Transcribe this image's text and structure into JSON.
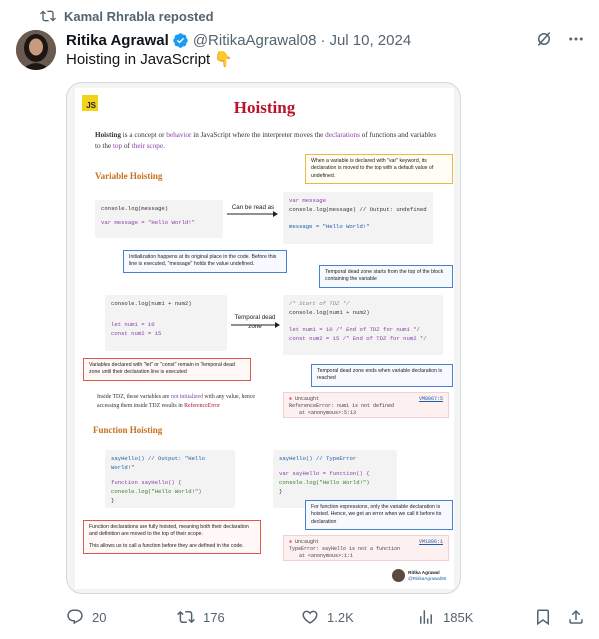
{
  "repost": {
    "text": "Kamal Rhrabla reposted"
  },
  "author": {
    "name": "Ritika Agrawal",
    "handle": "@RitikaAgrawal08",
    "date": "Jul 10, 2024"
  },
  "tweet": {
    "text": "Hoisting in JavaScript 👇"
  },
  "infographic": {
    "logo": "JS",
    "title": "Hoisting",
    "intro": {
      "term": "Hoisting",
      "p1": " is a concept or ",
      "behavior": "behavior",
      "p2": " in JavaScript where the interpreter moves the ",
      "declarations": "declarations",
      "p3": " of functions and variables to the ",
      "top": "top",
      "p4": " of ",
      "scope": "their scope",
      "p5": "."
    },
    "variable_hoisting": {
      "title": "Variable Hoisting",
      "code_left": [
        "console.log(message)",
        "var message = \"Hello World!\""
      ],
      "arrow_label": "Can be read as",
      "code_right": [
        "var message",
        "console.log(message)  // Output: undefined",
        "message = \"Hello World!\""
      ],
      "note_top": "When a variable is declared with \"var\" keyword, its declaration is moved to the top with a default value of undefined.",
      "note_bottom": "Initialization happens at its original place in the code. Before this line is executed, \"message\" holds the value undefined."
    },
    "tdz": {
      "code_left": [
        "console.log(num1 + num2)",
        "let num1 = 10",
        "const num2 = 15"
      ],
      "arrow_label": "Temporal dead zone",
      "code_right": [
        "/* Start of TDZ */",
        "console.log(num1 + num2)",
        "let num1 = 10 /* End of TDZ for num1 */",
        "const num2 = 15 /* End of TDZ for num2 */"
      ],
      "note_top": "Temporal dead zone starts from the top of the block containing the variable",
      "note_left": "Variables declared with \"let\" or \"const\" remain in Temporal dead zone until their declaration line is executed",
      "note_right": "Temporal dead zone ends when variable declaration is reached",
      "text_pre": "Inside TDZ, these variables are ",
      "text_red": "not initialized",
      "text_mid": " with any value, hence accessing them inside TDZ results in ",
      "text_err": "ReferenceError",
      "error": {
        "line1": "Uncaught",
        "line2": "ReferenceError: num1 is not defined",
        "line3": "at <anonymous>:5:13",
        "link": "VM8067:5"
      }
    },
    "function_hoisting": {
      "title": "Function Hoisting",
      "code_left": [
        "sayHello() // Output: \"Hello World!\"",
        "function sayHello() {",
        "console.log(\"Hello World!\")",
        "}"
      ],
      "code_right": [
        "sayHello() // TypeError",
        "var sayHello = function() {",
        "console.log(\"Hello World!\")",
        "}"
      ],
      "note_left_1": "Function declarations are fully hoisted, meaning both their declaration and definition are moved to the top of their scope.",
      "note_left_2": "This allows us to call a function before they are defined in the code.",
      "note_right": "For function expressions, only the variable declaration is hoisted. Hence, we get an error when we call it before its declaration",
      "error": {
        "line1": "Uncaught",
        "line2": "TypeError: sayHello is not a function",
        "line3": "at <anonymous>:1:1",
        "link": "VM1806:1"
      }
    },
    "badge": {
      "name": "Ritika Agrawal",
      "handle": "@RitikaAgrawal08"
    }
  },
  "actions": {
    "replies": "20",
    "reposts": "176",
    "likes": "1.2K",
    "views": "185K"
  },
  "colors": {
    "accent": "#1d9bf0",
    "secondary_text": "#536471",
    "title_red": "#b8132b",
    "section_orange": "#c8701e"
  }
}
